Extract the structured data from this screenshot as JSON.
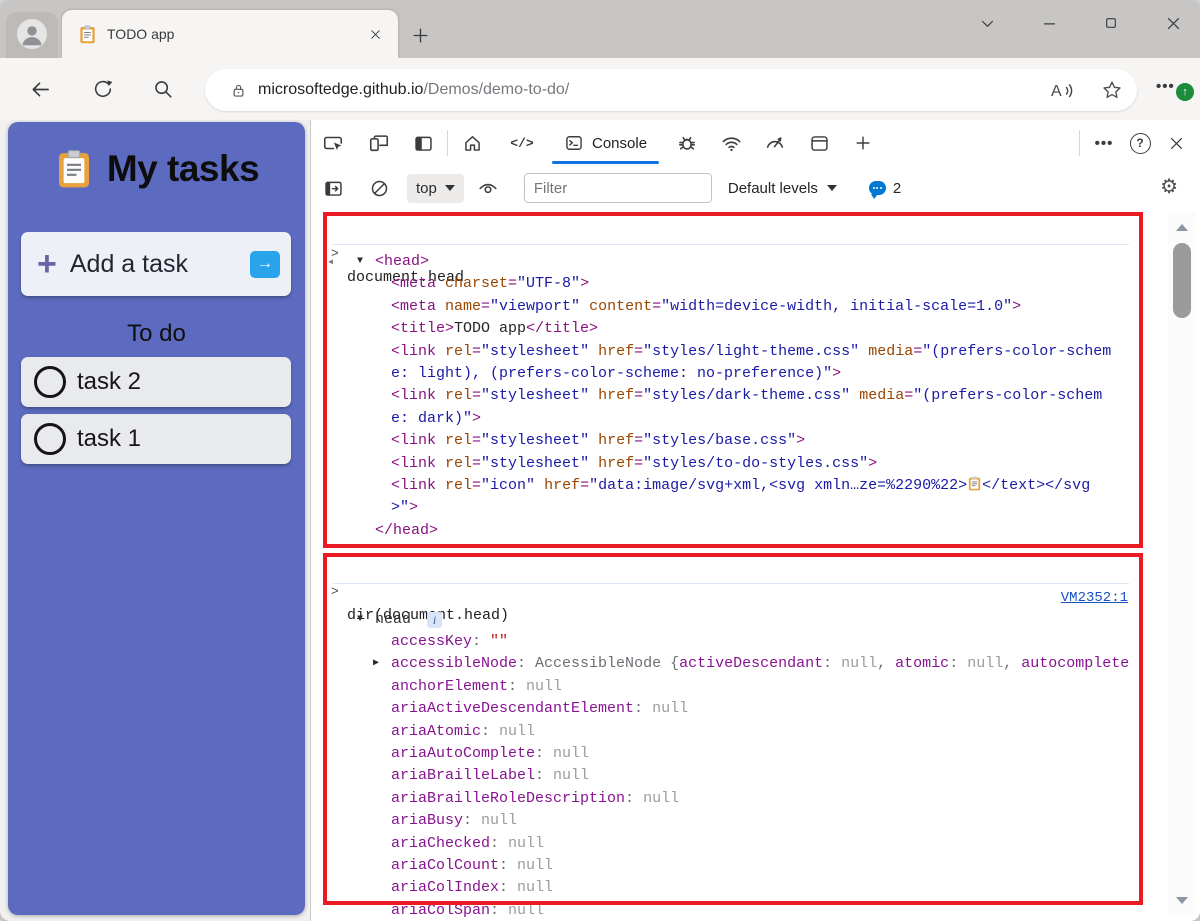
{
  "browser": {
    "tab_title": "TODO app",
    "url": {
      "domain": "microsoftedge.github.io",
      "path": "/Demos/demo-to-do/"
    }
  },
  "todo_app": {
    "title": "My tasks",
    "add_task_label": "Add a task",
    "section_heading": "To do",
    "tasks": [
      {
        "label": "task 2"
      },
      {
        "label": "task 1"
      }
    ]
  },
  "devtools": {
    "console_tab_label": "Console",
    "context_selector": "top",
    "filter_placeholder": "Filter",
    "log_levels_label": "Default levels",
    "issues_count": "2",
    "console": {
      "block1": {
        "command": "document.head",
        "root_open": "<head>",
        "root_close": "</head>",
        "lines": [
          [
            [
              "t",
              "<meta "
            ],
            [
              "a",
              "charset"
            ],
            [
              "t",
              "="
            ],
            [
              "v",
              "\"UTF-8\""
            ],
            [
              "t",
              ">"
            ]
          ],
          [
            [
              "t",
              "<meta "
            ],
            [
              "a",
              "name"
            ],
            [
              "t",
              "="
            ],
            [
              "v",
              "\"viewport\""
            ],
            [
              "t",
              " "
            ],
            [
              "a",
              "content"
            ],
            [
              "t",
              "="
            ],
            [
              "v",
              "\"width=device-width, initial-scale=1.0\""
            ],
            [
              "t",
              ">"
            ]
          ],
          [
            [
              "t",
              "<title>"
            ],
            [
              "x",
              "TODO app"
            ],
            [
              "t",
              "</title>"
            ]
          ],
          [
            [
              "t",
              "<link "
            ],
            [
              "a",
              "rel"
            ],
            [
              "t",
              "="
            ],
            [
              "v",
              "\"stylesheet\""
            ],
            [
              "t",
              " "
            ],
            [
              "a",
              "href"
            ],
            [
              "t",
              "="
            ],
            [
              "v",
              "\"styles/light-theme.css\""
            ],
            [
              "t",
              " "
            ],
            [
              "a",
              "media"
            ],
            [
              "t",
              "="
            ],
            [
              "v",
              "\"(prefers-color-schem"
            ]
          ],
          [
            [
              "v",
              "e: light), (prefers-color-scheme: no-preference)\""
            ],
            [
              "t",
              ">"
            ]
          ],
          [
            [
              "t",
              "<link "
            ],
            [
              "a",
              "rel"
            ],
            [
              "t",
              "="
            ],
            [
              "v",
              "\"stylesheet\""
            ],
            [
              "t",
              " "
            ],
            [
              "a",
              "href"
            ],
            [
              "t",
              "="
            ],
            [
              "v",
              "\"styles/dark-theme.css\""
            ],
            [
              "t",
              " "
            ],
            [
              "a",
              "media"
            ],
            [
              "t",
              "="
            ],
            [
              "v",
              "\"(prefers-color-schem"
            ]
          ],
          [
            [
              "v",
              "e: dark)\""
            ],
            [
              "t",
              ">"
            ]
          ],
          [
            [
              "t",
              "<link "
            ],
            [
              "a",
              "rel"
            ],
            [
              "t",
              "="
            ],
            [
              "v",
              "\"stylesheet\""
            ],
            [
              "t",
              " "
            ],
            [
              "a",
              "href"
            ],
            [
              "t",
              "="
            ],
            [
              "v",
              "\"styles/base.css\""
            ],
            [
              "t",
              ">"
            ]
          ],
          [
            [
              "t",
              "<link "
            ],
            [
              "a",
              "rel"
            ],
            [
              "t",
              "="
            ],
            [
              "v",
              "\"stylesheet\""
            ],
            [
              "t",
              " "
            ],
            [
              "a",
              "href"
            ],
            [
              "t",
              "="
            ],
            [
              "v",
              "\"styles/to-do-styles.css\""
            ],
            [
              "t",
              ">"
            ]
          ],
          [
            [
              "t",
              "<link "
            ],
            [
              "a",
              "rel"
            ],
            [
              "t",
              "="
            ],
            [
              "v",
              "\"icon\""
            ],
            [
              "t",
              " "
            ],
            [
              "a",
              "href"
            ],
            [
              "t",
              "="
            ],
            [
              "v",
              "\"data:image/svg+xml,<svg xmln…ze=%2290%22>"
            ],
            [
              "ic",
              ""
            ],
            [
              "v",
              "</text></svg"
            ]
          ],
          [
            [
              "v",
              ">\""
            ],
            [
              "t",
              ">"
            ]
          ]
        ]
      },
      "block2": {
        "command": "dir(document.head)",
        "source_link": "VM2352:1",
        "object_name": "head",
        "info_badge": "i",
        "props": [
          {
            "key": "accessKey",
            "value": "\"\"",
            "vtype": "s"
          },
          {
            "key": "accessibleNode",
            "expandable": true,
            "preview": [
              [
                "c",
                "AccessibleNode "
              ],
              [
                "p",
                "{"
              ],
              [
                "k2",
                "activeDescendant"
              ],
              [
                "p",
                ": "
              ],
              [
                "n",
                "null"
              ],
              [
                "p",
                ", "
              ],
              [
                "k2",
                "atomic"
              ],
              [
                "p",
                ": "
              ],
              [
                "n",
                "null"
              ],
              [
                "p",
                ", "
              ],
              [
                "k2",
                "autocomplete"
              ]
            ]
          },
          {
            "key": "anchorElement",
            "value": "null",
            "vtype": "n"
          },
          {
            "key": "ariaActiveDescendantElement",
            "value": "null",
            "vtype": "n"
          },
          {
            "key": "ariaAtomic",
            "value": "null",
            "vtype": "n"
          },
          {
            "key": "ariaAutoComplete",
            "value": "null",
            "vtype": "n"
          },
          {
            "key": "ariaBrailleLabel",
            "value": "null",
            "vtype": "n"
          },
          {
            "key": "ariaBrailleRoleDescription",
            "value": "null",
            "vtype": "n"
          },
          {
            "key": "ariaBusy",
            "value": "null",
            "vtype": "n"
          },
          {
            "key": "ariaChecked",
            "value": "null",
            "vtype": "n"
          },
          {
            "key": "ariaColCount",
            "value": "null",
            "vtype": "n"
          },
          {
            "key": "ariaColIndex",
            "value": "null",
            "vtype": "n"
          },
          {
            "key": "ariaColSpan",
            "value": "null",
            "vtype": "n"
          }
        ]
      }
    }
  },
  "icons": {
    "clipboard": "orange clipboard emoji",
    "plus": "+",
    "arrow_right": "→",
    "search": "magnifier",
    "lock": "padlock",
    "read_aloud": "A with sound waves",
    "favorite": "star",
    "more": "three dots",
    "update_badge": "green circle up arrow",
    "settings": "gear",
    "clear_console": "circle slash",
    "live_expression": "eye",
    "issues": "speech bubble"
  },
  "colors": {
    "accent_blue": "#1273E6",
    "annotation_red": "#EA1B23",
    "todo_purple": "#5C6BC0",
    "add_button_blue": "#29A3E9",
    "issues_bubble_blue": "#0078D4",
    "update_badge_green": "#1C8C3C"
  }
}
